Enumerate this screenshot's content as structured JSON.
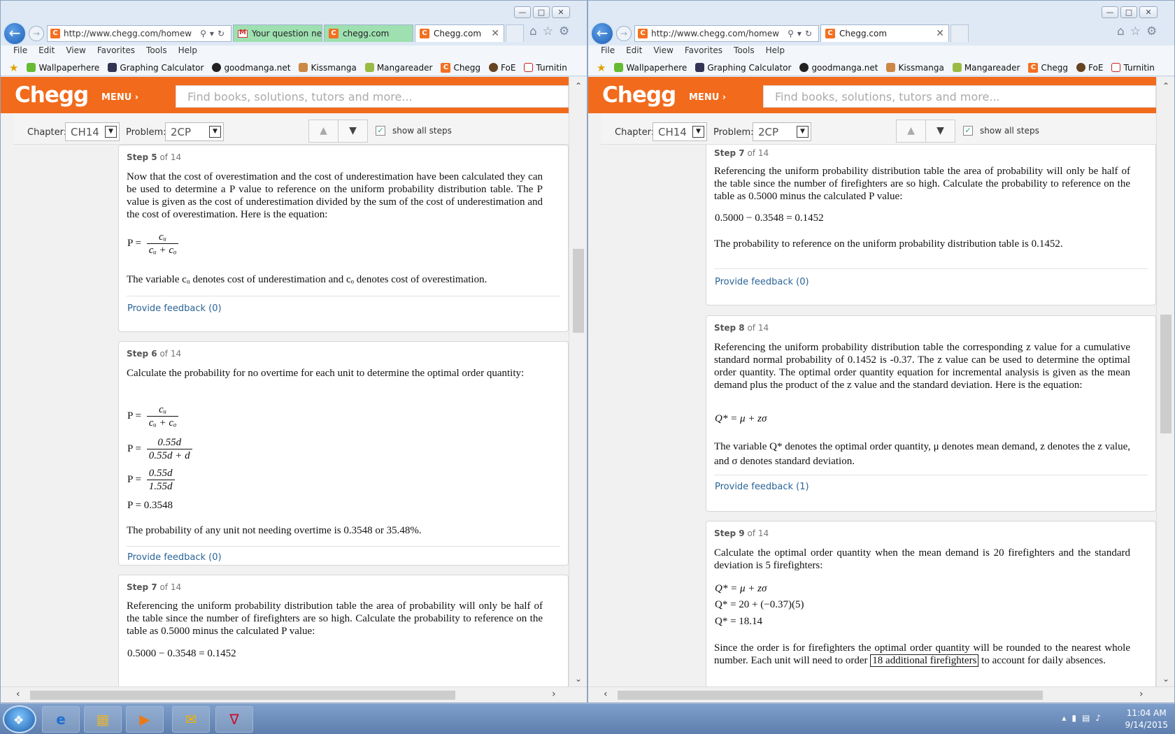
{
  "left": {
    "tabs": [
      "Your question ne...",
      "chegg.com",
      "Chegg.com"
    ],
    "address": "http://www.chegg.com/homew",
    "chapter": "CH14",
    "problem": "2CP",
    "steps": [
      {
        "num": "Step 5",
        "of": "of 14",
        "p1": "Now that the cost of overestimation and the cost of underestimation have been calculated they can be used to determine a P value to reference on the uniform probability distribution table.  The P value is given as the cost of underestimation divided by the sum of the cost of underestimation and the cost of overestimation.  Here is the equation:",
        "p2": "The variable cᵤ denotes cost of underestimation and cₒ denotes cost of overestimation.",
        "feedback": "Provide feedback (0)"
      },
      {
        "num": "Step 6",
        "of": "of 14",
        "p1": "Calculate the probability for no overtime for each unit to determine the optimal order quantity:",
        "result": "P = 0.3548",
        "p2": "The probability of any unit not needing overtime is 0.3548 or 35.48%.",
        "feedback": "Provide feedback (0)"
      },
      {
        "num": "Step 7",
        "of": "of 14",
        "p1": "Referencing the uniform probability distribution table the area of probability will only be half of the table since the number of firefighters are so high.  Calculate the probability to reference on the table as 0.5000 minus the calculated P value:",
        "eq": "0.5000 − 0.3548 = 0.1452"
      }
    ]
  },
  "right": {
    "tabs": [
      "Chegg.com"
    ],
    "address": "http://www.chegg.com/homew",
    "chapter": "CH14",
    "problem": "2CP",
    "steps": [
      {
        "num": "Step 7",
        "of": "of 14",
        "p1": "Referencing the uniform probability distribution table the area of probability will only be half of the table since the number of firefighters are so high.  Calculate the probability to reference on the table as 0.5000 minus the calculated P value:",
        "eq": "0.5000 − 0.3548 = 0.1452",
        "p2": "The probability to reference on the uniform probability distribution table is 0.1452.",
        "feedback": "Provide feedback (0)"
      },
      {
        "num": "Step 8",
        "of": "of 14",
        "p1": "Referencing the uniform probability distribution table the corresponding z value for a cumulative standard normal probability of 0.1452 is -0.37.  The z value can be used to determine the optimal order quantity.  The optimal order quantity equation for incremental analysis is given as the mean demand plus the product of the z value and the standard deviation.  Here is the equation:",
        "eq": "Q* = μ + zσ",
        "p2": "The variable Q* denotes the optimal order quantity,  μ  denotes mean demand, z denotes the z value, and σ  denotes standard deviation.",
        "feedback": "Provide feedback (1)"
      },
      {
        "num": "Step 9",
        "of": "of 14",
        "p1": "Calculate the optimal order quantity when the mean demand is 20 firefighters and the standard deviation is 5 firefighters:",
        "eq1": "Q* = μ + zσ",
        "eq2": "Q* = 20 + (−0.37)(5)",
        "eq3": "Q* = 18.14",
        "p2a": "Since the order is for firefighters the optimal order quantity will be rounded to the nearest whole number.  Each unit will need to order",
        "p2b": "18 additional firefighters",
        "p2c": "to account for daily absences."
      }
    ]
  },
  "common": {
    "menu": [
      "File",
      "Edit",
      "View",
      "Favorites",
      "Tools",
      "Help"
    ],
    "favorites": [
      "Wallpaperhere",
      "Graphing Calculator",
      "goodmanga.net",
      "Kissmanga",
      "Mangareader",
      "Chegg",
      "FoE",
      "Turnitin"
    ],
    "logo": "Chegg",
    "menu_btn": "MENU",
    "search_placeholder": "Find books, solutions, tutors and more...",
    "chapter_label": "Chapter:",
    "problem_label": "Problem:",
    "show_all_steps": "show all steps",
    "p_eq_lhs": "P =",
    "cu": "cᵤ",
    "cu_plus_co": "cᵤ + cₒ",
    "frac2_num": "0.55d",
    "frac2_den": "0.55d + d",
    "frac3_num": "0.55d",
    "frac3_den": "1.55d"
  },
  "taskbar": {
    "time": "11:04 AM",
    "date": "9/14/2015"
  }
}
